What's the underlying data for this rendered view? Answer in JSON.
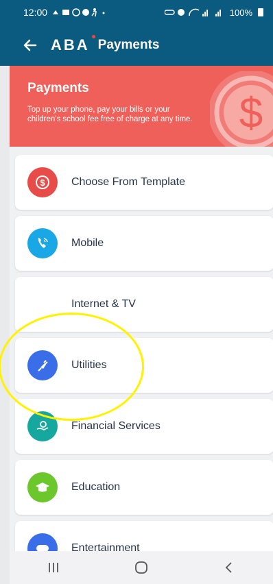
{
  "status_bar": {
    "time": "12:00",
    "battery": "100%"
  },
  "app_bar": {
    "logo": "ABA",
    "title": "Payments"
  },
  "banner": {
    "title": "Payments",
    "description": "Top up your phone, pay your bills or your children's school fee free of charge at any time.",
    "icon": "dollar-coin-icon",
    "color": "#ee6059"
  },
  "items": [
    {
      "label": "Choose From Template",
      "icon": "dollar-icon",
      "color": "#e84c48"
    },
    {
      "label": "Mobile",
      "icon": "phone-icon",
      "color": "#1aa7e6"
    },
    {
      "label": "Internet & TV",
      "icon": "",
      "color": ""
    },
    {
      "label": "Utilities",
      "icon": "plug-icon",
      "color": "#3a6ee8"
    },
    {
      "label": "Financial Services",
      "icon": "money-hand-icon",
      "color": "#16a89e"
    },
    {
      "label": "Education",
      "icon": "graduation-cap-icon",
      "color": "#6cc72d"
    },
    {
      "label": "Entertainment",
      "icon": "gamepad-icon",
      "color": "#3a6ee8"
    }
  ],
  "nav": {
    "recent": "recent-apps-icon",
    "home": "home-icon",
    "back": "back-chevron-icon"
  },
  "colors": {
    "primary": "#0b5b80",
    "annotation": "#fff200"
  }
}
